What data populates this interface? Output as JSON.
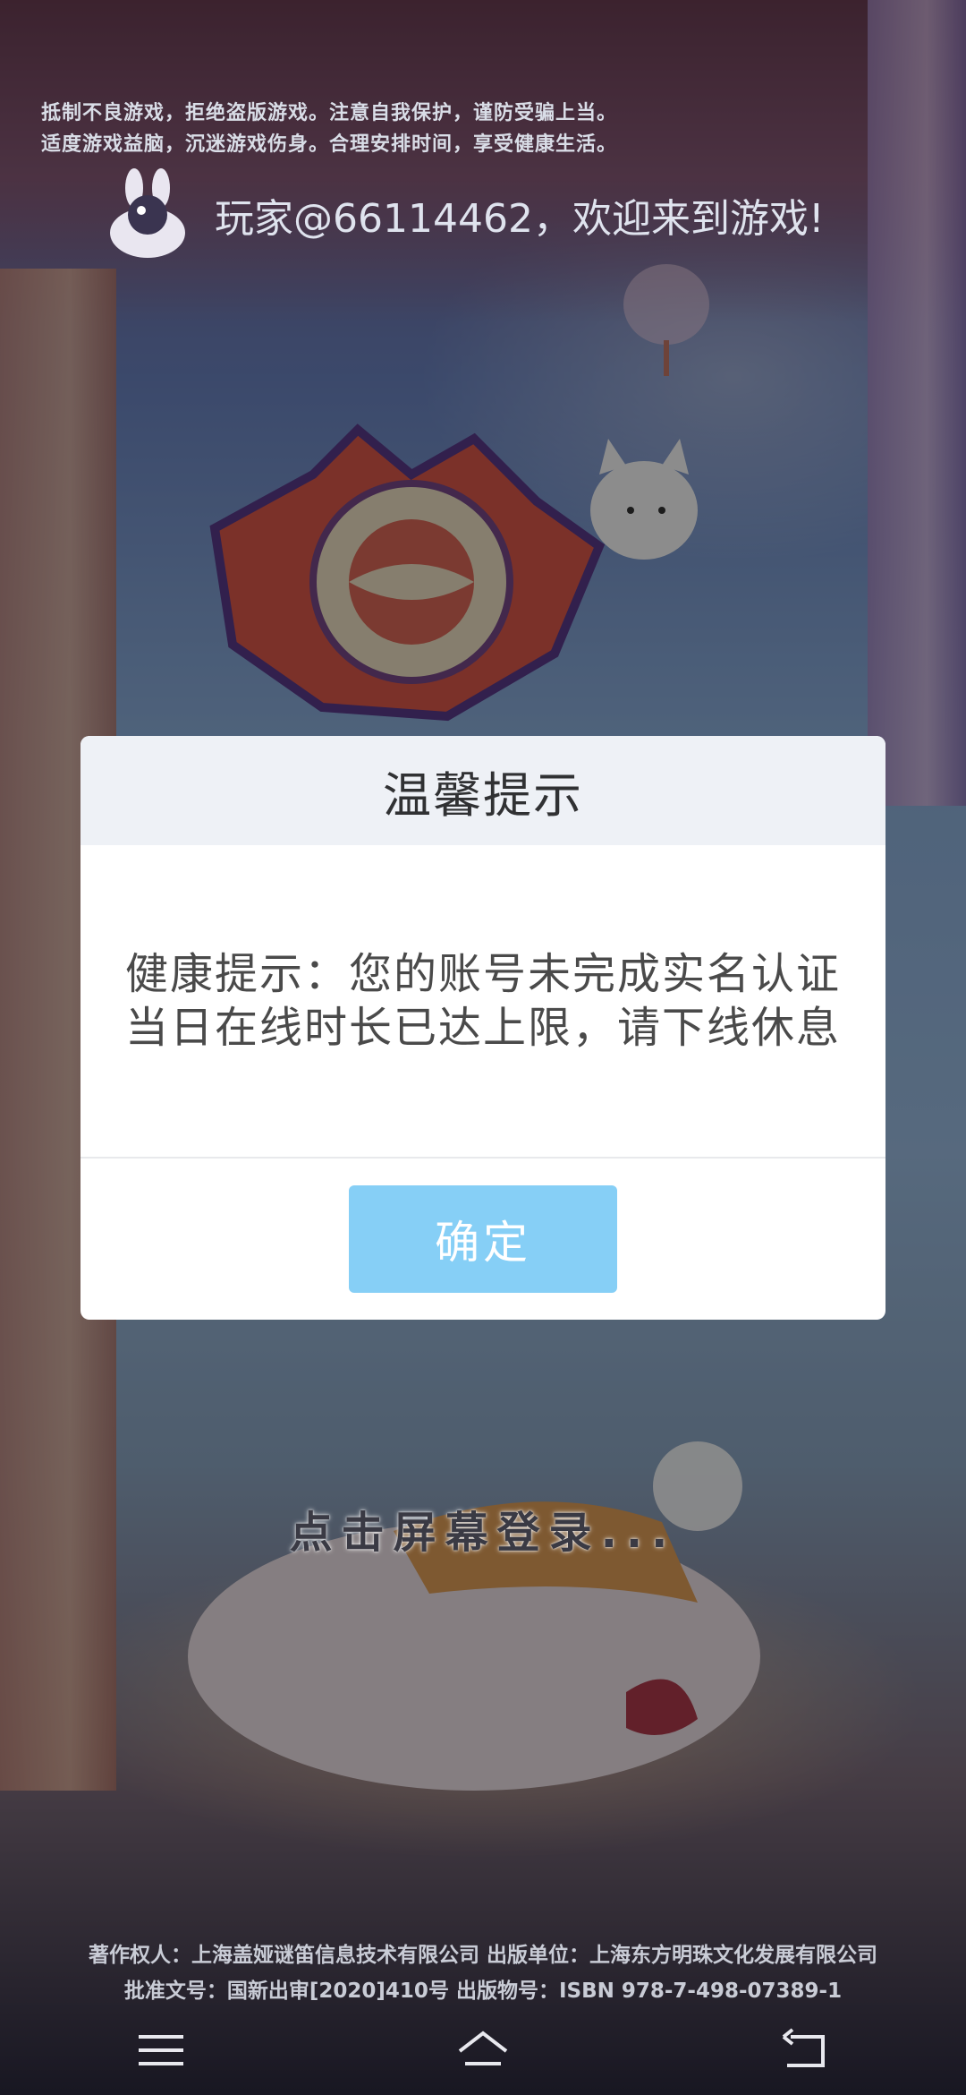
{
  "notices": {
    "line1": "抵制不良游戏，拒绝盗版游戏。注意自我保护，谨防受骗上当。",
    "line2": "适度游戏益脑，沉迷游戏伤身。合理安排时间，享受健康生活。"
  },
  "welcome": "玩家@66114462，欢迎来到游戏!",
  "dialog": {
    "title": "温馨提示",
    "message": "健康提示：您的账号未完成实名认证当日在线时长已达上限，请下线休息",
    "confirm_label": "确定"
  },
  "tap_to_login": "点击屏幕登录...",
  "copyright": {
    "line1": "著作权人：上海盖娅谜笛信息技术有限公司 出版单位：上海东方明珠文化发展有限公司",
    "line2": "批准文号：国新出审[2020]410号  出版物号：ISBN 978-7-498-07389-1"
  },
  "navbar": {
    "icons": [
      "menu-icon",
      "home-icon",
      "back-icon"
    ]
  }
}
